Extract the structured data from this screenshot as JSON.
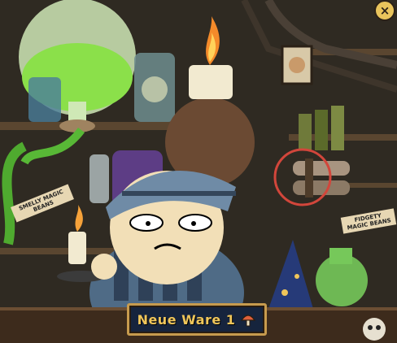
{
  "shop": {
    "new_items_label": "Neue Ware 1",
    "close_label": "×",
    "sign_left": "SMELLY MAGIC BEANS",
    "sign_right": "FIDGETY MAGIC BEANS",
    "highlighted_item": "tied-scroll-bundle"
  },
  "icons": {
    "new_items_icon": "mushroom-icon",
    "close_icon": "close-icon"
  },
  "colors": {
    "button_bg": "#16243d",
    "button_border": "#c79b4e",
    "button_text": "#f0c65a",
    "highlight_circle": "#d2463b",
    "potion_green": "#8be04a"
  }
}
